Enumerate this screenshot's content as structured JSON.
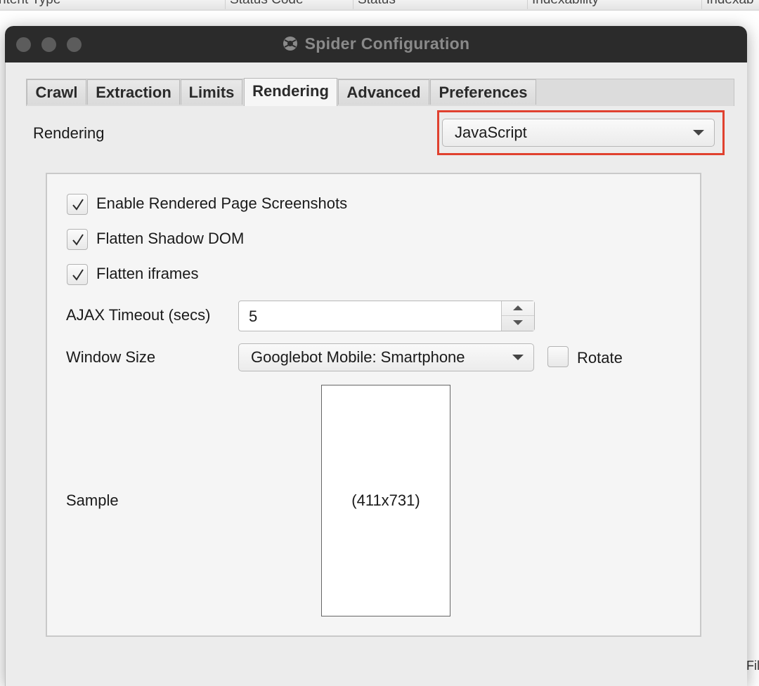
{
  "background_table": {
    "columns": [
      "ntent Type",
      "Status Code",
      "Status",
      "Indexability",
      "Indexab"
    ],
    "edge_text": "Fil"
  },
  "window": {
    "title": "Spider Configuration",
    "app_icon": "spider-icon"
  },
  "tabs": [
    {
      "label": "Crawl",
      "active": false
    },
    {
      "label": "Extraction",
      "active": false
    },
    {
      "label": "Limits",
      "active": false
    },
    {
      "label": "Rendering",
      "active": true
    },
    {
      "label": "Advanced",
      "active": false
    },
    {
      "label": "Preferences",
      "active": false
    }
  ],
  "rendering": {
    "label": "Rendering",
    "selected": "JavaScript",
    "highlight_color": "#e0412f"
  },
  "options": {
    "screenshots": {
      "label": "Enable Rendered Page Screenshots",
      "checked": true
    },
    "shadow_dom": {
      "label": "Flatten Shadow DOM",
      "checked": true
    },
    "iframes": {
      "label": "Flatten iframes",
      "checked": true
    }
  },
  "ajax": {
    "label": "AJAX Timeout (secs)",
    "value": "5"
  },
  "window_size": {
    "label": "Window Size",
    "selected": "Googlebot Mobile: Smartphone",
    "rotate_label": "Rotate",
    "rotate_checked": false
  },
  "sample": {
    "label": "Sample",
    "dimensions": "(411x731)"
  }
}
